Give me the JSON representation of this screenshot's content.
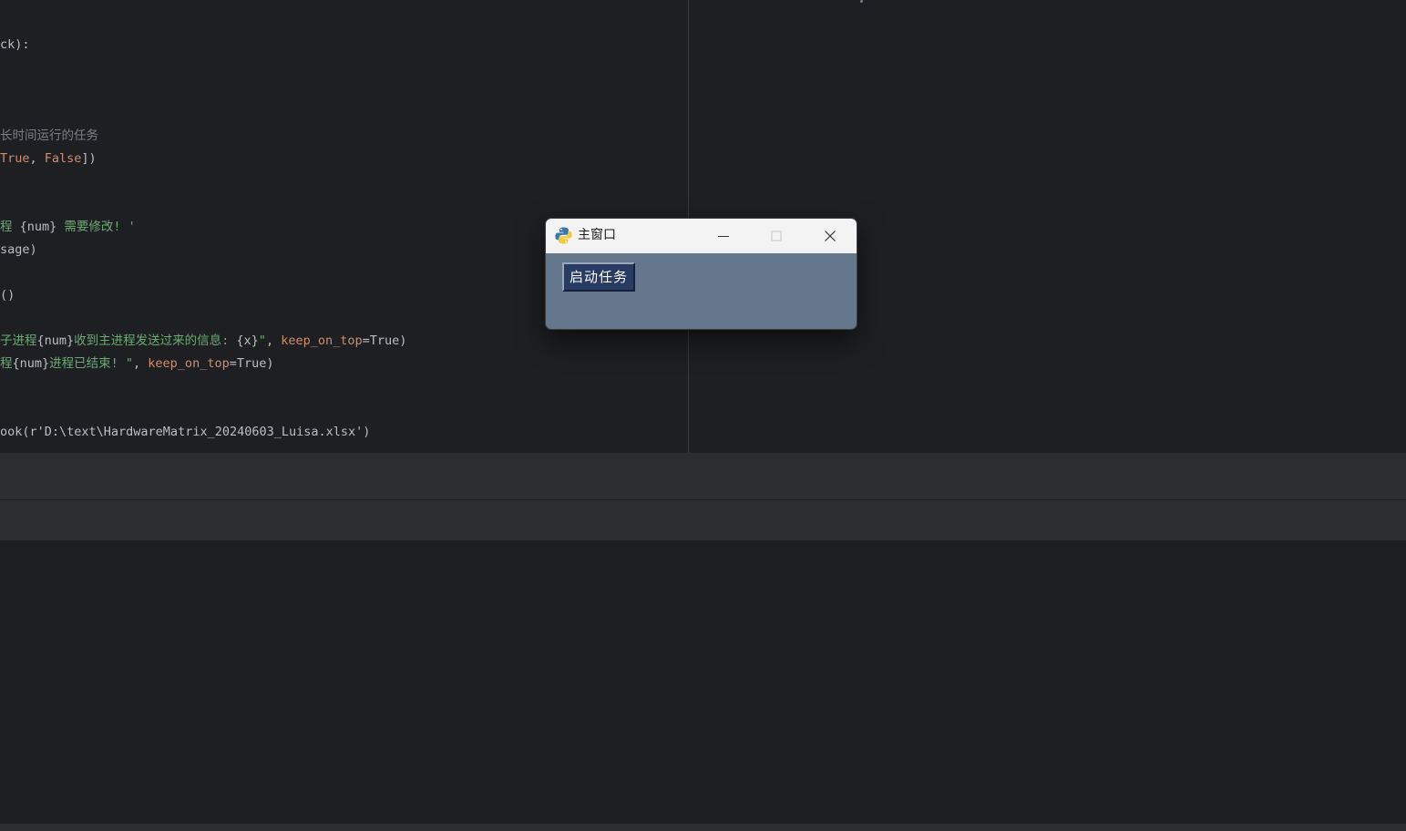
{
  "editor": {
    "lines": [
      {
        "segments": [
          {
            "t": "ck):",
            "c": "plain"
          }
        ]
      },
      {
        "segments": [
          {
            "t": "长时间运行的任务",
            "c": "comment"
          }
        ]
      },
      {
        "segments": [
          {
            "t": "True",
            "c": "keyword"
          },
          {
            "t": ", ",
            "c": "plain"
          },
          {
            "t": "False",
            "c": "keyword"
          },
          {
            "t": "])",
            "c": "plain"
          }
        ]
      },
      {
        "segments": [
          {
            "t": "程 ",
            "c": "string"
          },
          {
            "t": "{num}",
            "c": "plain"
          },
          {
            "t": " 需要修改! '",
            "c": "string"
          }
        ]
      },
      {
        "segments": [
          {
            "t": "sage)",
            "c": "plain"
          }
        ]
      },
      {
        "segments": [
          {
            "t": "()",
            "c": "plain"
          }
        ]
      },
      {
        "segments": [
          {
            "t": "子进程",
            "c": "string"
          },
          {
            "t": "{num}",
            "c": "plain"
          },
          {
            "t": "收到主进程发送过来的信息: ",
            "c": "string"
          },
          {
            "t": "{x}",
            "c": "plain"
          },
          {
            "t": "\"",
            "c": "string"
          },
          {
            "t": ", ",
            "c": "plain"
          },
          {
            "t": "keep_on_top",
            "c": "param"
          },
          {
            "t": "=True)",
            "c": "plain"
          }
        ]
      },
      {
        "segments": [
          {
            "t": "程",
            "c": "string"
          },
          {
            "t": "{num}",
            "c": "plain"
          },
          {
            "t": "进程已结束! \"",
            "c": "string"
          },
          {
            "t": ", ",
            "c": "plain"
          },
          {
            "t": "keep_on_top",
            "c": "param"
          },
          {
            "t": "=True)",
            "c": "plain"
          }
        ]
      },
      {
        "segments": [
          {
            "t": "ook(r'D:\\text\\HardwareMatrix_20240603_Luisa.xlsx')",
            "c": "plain"
          }
        ]
      }
    ]
  },
  "tk_window": {
    "title": "主窗口",
    "app_icon": "python-icon",
    "controls": {
      "minimize": "minimize-icon",
      "maximize": "maximize-icon",
      "close": "close-icon"
    },
    "button_label": "启动任务",
    "body_color": "#64778d",
    "button_color": "#283b63"
  },
  "colors": {
    "editor_bg": "#1e1f22",
    "panel_bg": "#2b2d30",
    "string": "#6aab73",
    "keyword": "#cf8e6d",
    "comment": "#7a7e85",
    "text": "#bcbec4"
  }
}
